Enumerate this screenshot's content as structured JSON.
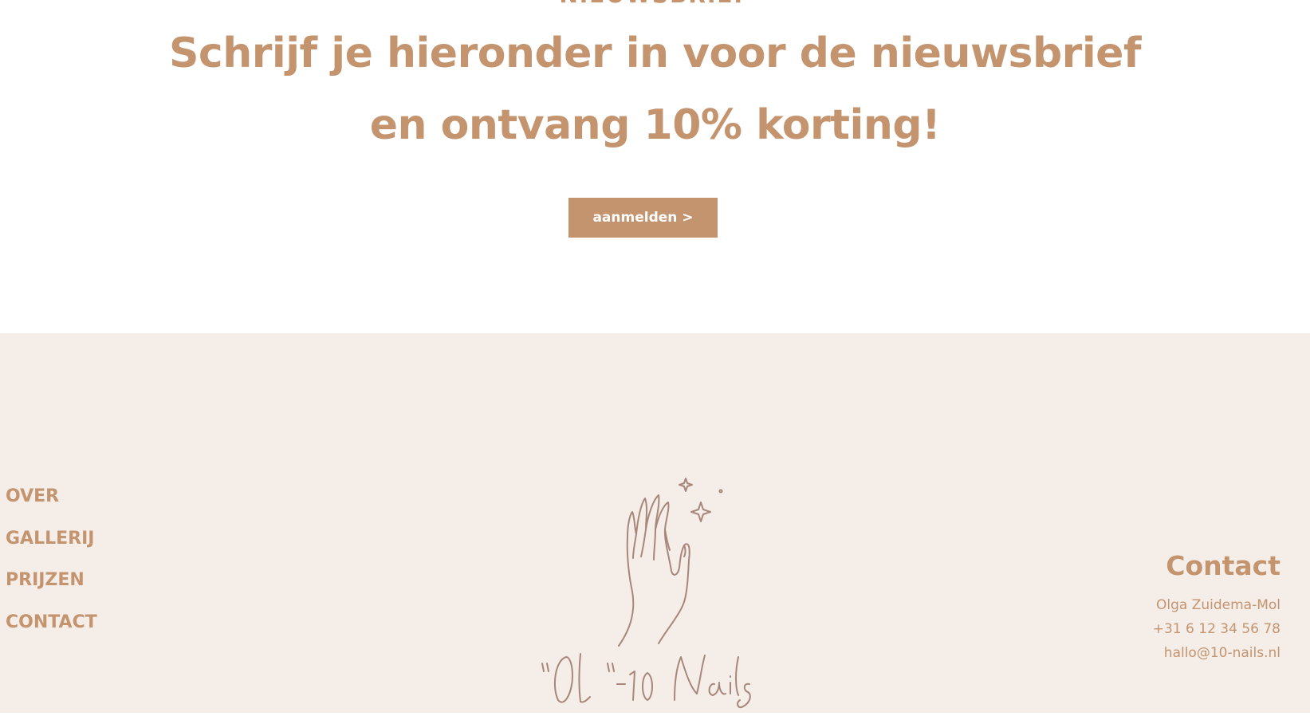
{
  "newsletter": {
    "kicker": "NIEUWSBRIEF",
    "headline": "Schrijf je hieronder in voor de nieuwsbrief en ontvang 10% korting!",
    "button_label": "aanmelden >"
  },
  "footer": {
    "nav": [
      {
        "label": "OVER"
      },
      {
        "label": "GALLERIJ"
      },
      {
        "label": "PRIJZEN"
      },
      {
        "label": "CONTACT"
      }
    ],
    "logo": {
      "name": "hand-sparkles-logo",
      "text": "\"Ol\"-10 Nails"
    },
    "contact": {
      "title": "Contact",
      "name": "Olga Zuidema-Mol",
      "phone": "+31 6 12 34 56 78",
      "email": "hallo@10-nails.nl"
    }
  },
  "colors": {
    "accent": "#c4946f",
    "footer_bg": "#f5ede8",
    "logo_stroke": "#a8877b"
  }
}
